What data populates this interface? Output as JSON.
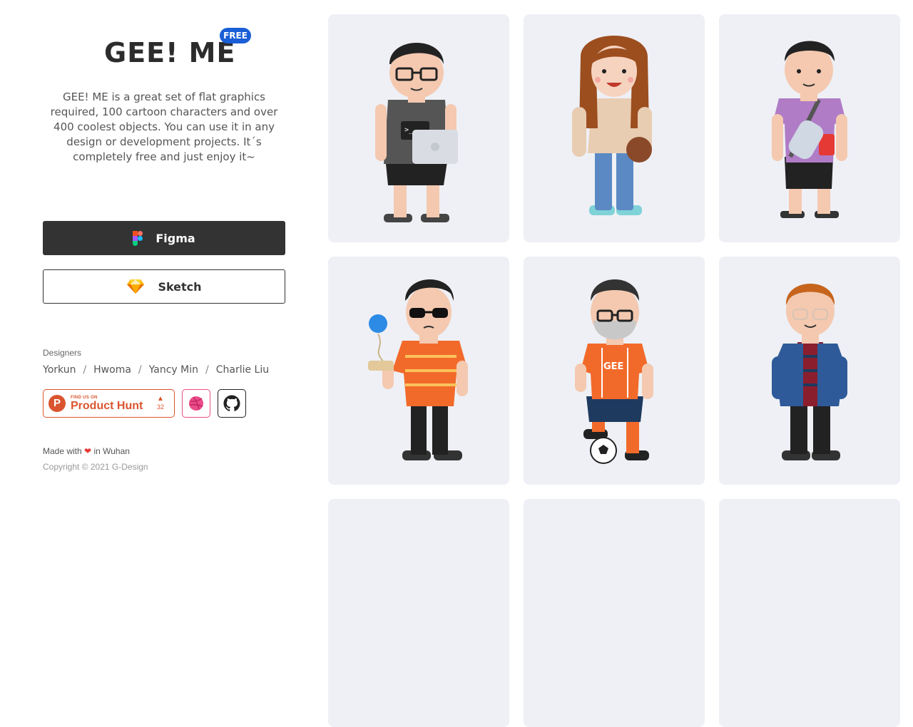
{
  "brand": {
    "logo": "GEE! ME",
    "badge": "FREE"
  },
  "description": "GEE! ME is a great set of flat graphics required, 100 cartoon characters and over 400 coolest objects. You can use it in any design or development projects. It´s completely free and just enjoy it~",
  "buttons": {
    "figma": "Figma",
    "sketch": "Sketch"
  },
  "designers": {
    "label": "Designers",
    "names": [
      "Yorkun",
      "Hwoma",
      "Yancy Min",
      "Charlie Liu"
    ],
    "separator": "/"
  },
  "producthunt": {
    "small": "FIND US ON",
    "big": "Product Hunt",
    "votes": "32",
    "icon": "producthunt-icon"
  },
  "social": {
    "dribbble_icon": "dribbble-icon",
    "github_icon": "github-icon"
  },
  "footer": {
    "made_prefix": "Made with",
    "made_suffix": "in Wuhan",
    "heart_icon": "heart-icon",
    "copyright": "Copyright © 2021 G-Design"
  },
  "colors": {
    "figma_bg": "#333333",
    "badge": "#1a5fd6",
    "card_bg": "#eef0f5",
    "producthunt": "#da552f",
    "dribbble": "#ea4c89"
  },
  "characters": [
    {
      "name": "developer-with-laptop"
    },
    {
      "name": "girl-with-bag"
    },
    {
      "name": "guy-with-bottle"
    },
    {
      "name": "guy-with-kendama"
    },
    {
      "name": "soccer-player-gee"
    },
    {
      "name": "guy-in-denim-jacket"
    }
  ]
}
